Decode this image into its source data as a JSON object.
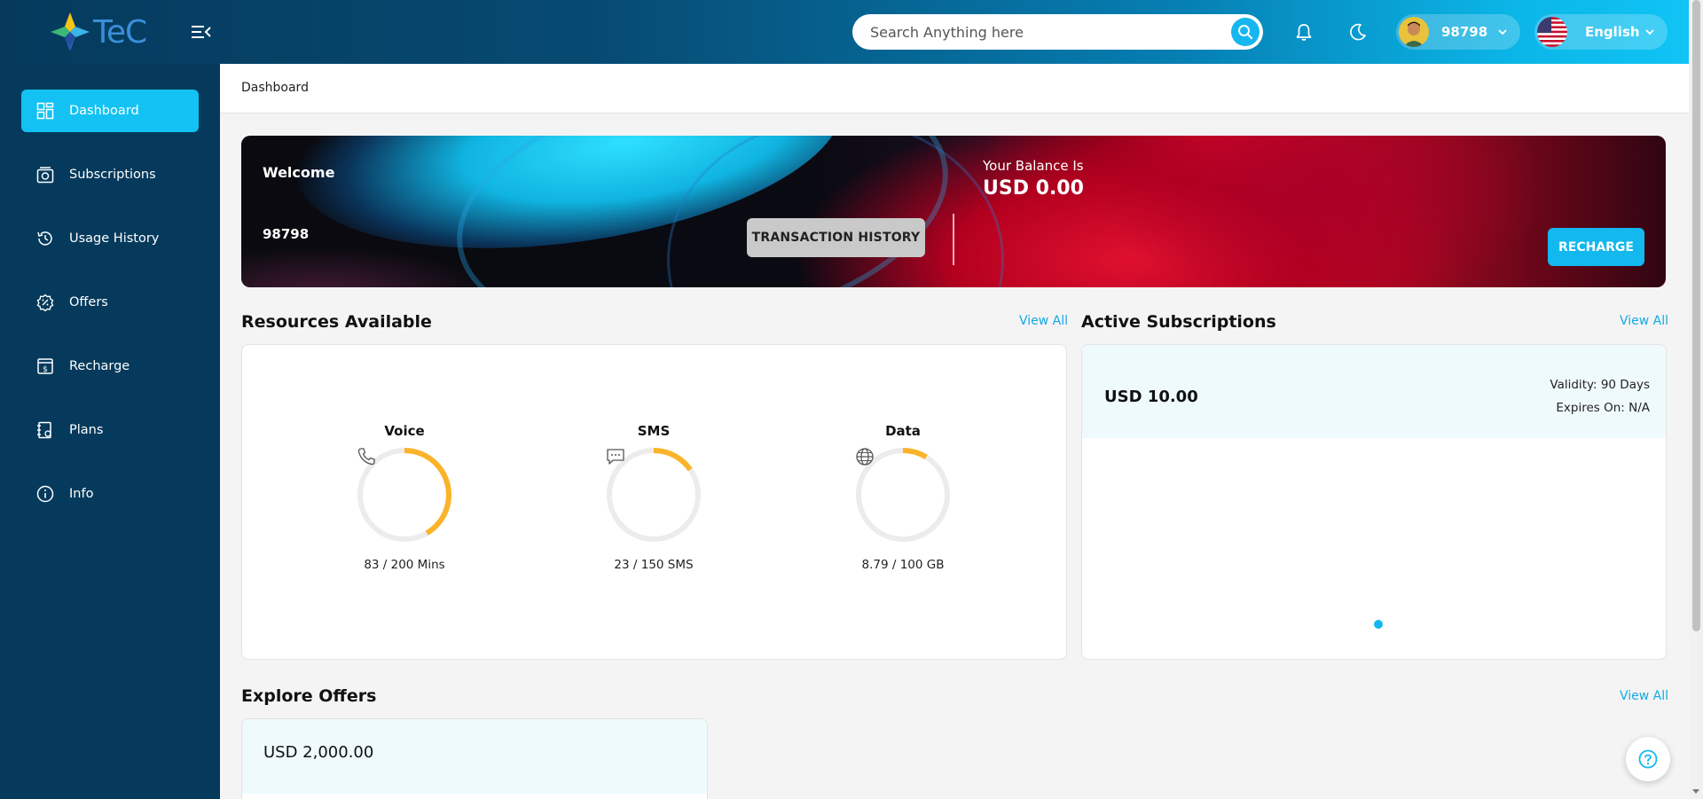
{
  "header": {
    "logo_text": "TeC",
    "search": {
      "placeholder": "Search Anything here"
    },
    "user": {
      "id": "98798"
    },
    "language": {
      "selected": "English"
    },
    "icons": [
      "menu-collapse-icon",
      "search-icon",
      "bell-icon",
      "moon-icon",
      "chevron-down-icon",
      "us-flag-icon"
    ]
  },
  "sidebar": {
    "items": [
      {
        "label": "Dashboard",
        "icon": "dashboard-icon",
        "active": true
      },
      {
        "label": "Subscriptions",
        "icon": "subscriptions-icon",
        "active": false
      },
      {
        "label": "Usage History",
        "icon": "history-icon",
        "active": false
      },
      {
        "label": "Offers",
        "icon": "offers-icon",
        "active": false
      },
      {
        "label": "Recharge",
        "icon": "recharge-icon",
        "active": false
      },
      {
        "label": "Plans",
        "icon": "plans-icon",
        "active": false
      },
      {
        "label": "Info",
        "icon": "info-icon",
        "active": false
      }
    ]
  },
  "breadcrumb": {
    "current": "Dashboard"
  },
  "banner": {
    "welcome": "Welcome",
    "account_id": "98798",
    "history_button": "TRANSACTION HISTORY",
    "balance_label": "Your Balance Is",
    "balance_value": "USD 0.00",
    "recharge_button": "RECHARGE"
  },
  "resources": {
    "title": "Resources Available",
    "view_all": "View All",
    "items": [
      {
        "label": "Voice",
        "value": "83 / 200 Mins",
        "used": 83,
        "total": 200,
        "icon": "phone-icon"
      },
      {
        "label": "SMS",
        "value": "23 / 150 SMS",
        "used": 23,
        "total": 150,
        "icon": "chat-icon"
      },
      {
        "label": "Data",
        "value": "8.79 / 100 GB",
        "used": 8.79,
        "total": 100,
        "icon": "globe-icon"
      }
    ]
  },
  "subscriptions": {
    "title": "Active Subscriptions",
    "view_all": "View All",
    "price": "USD 10.00",
    "validity": "Validity: 90 Days",
    "expires": "Expires On: N/A"
  },
  "offers": {
    "title": "Explore Offers",
    "view_all": "View All",
    "first_price": "USD 2,000.00"
  },
  "colors": {
    "sidebar_bg": "#053a5c",
    "accent": "#13c2f3",
    "gauge_fill": "#fbb32a",
    "gauge_track": "#ececec"
  }
}
